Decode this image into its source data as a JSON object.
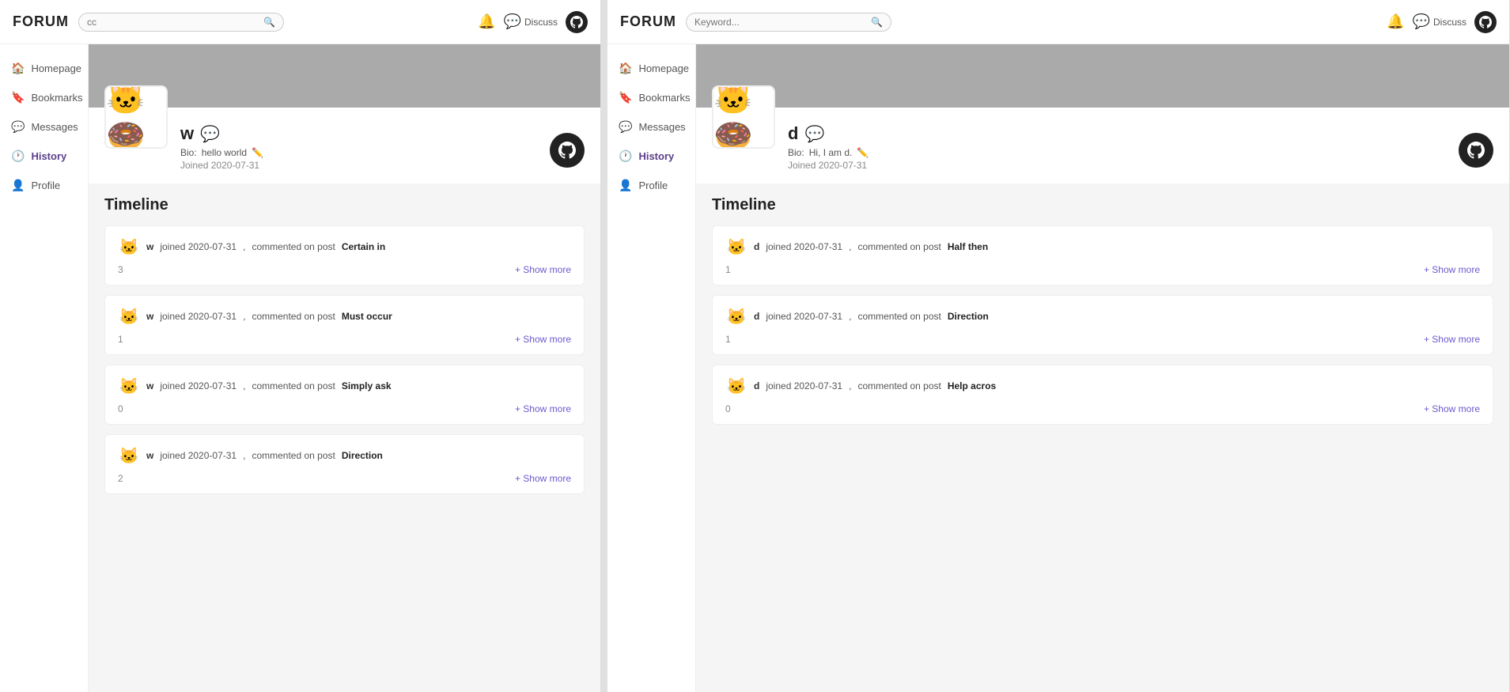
{
  "left": {
    "header": {
      "logo": "FORUM",
      "search_placeholder": "cc",
      "discuss_label": "Discuss"
    },
    "sidebar": {
      "items": [
        {
          "id": "homepage",
          "label": "Homepage",
          "icon": "⌂"
        },
        {
          "id": "bookmarks",
          "label": "Bookmarks",
          "icon": "🔖"
        },
        {
          "id": "messages",
          "label": "Messages",
          "icon": "💬"
        },
        {
          "id": "history",
          "label": "History",
          "icon": "🕐",
          "active": true
        },
        {
          "id": "profile",
          "label": "Profile",
          "icon": "👤"
        }
      ]
    },
    "profile": {
      "username": "w",
      "bio_label": "Bio:",
      "bio_value": "hello world",
      "joined_label": "Joined",
      "joined_date": "2020-07-31",
      "avatar_emoji": "🍩"
    },
    "timeline": {
      "title": "Timeline",
      "entries": [
        {
          "user": "w",
          "joined": "joined 2020-07-31",
          "action": "commented on post",
          "post": "Certain in",
          "count": "3"
        },
        {
          "user": "w",
          "joined": "joined 2020-07-31",
          "action": "commented on post",
          "post": "Must occur",
          "count": "1"
        },
        {
          "user": "w",
          "joined": "joined 2020-07-31",
          "action": "commented on post",
          "post": "Simply ask",
          "count": "0"
        },
        {
          "user": "w",
          "joined": "joined 2020-07-31",
          "action": "commented on post",
          "post": "Direction",
          "count": "2"
        }
      ]
    }
  },
  "right": {
    "header": {
      "logo": "FORUM",
      "search_placeholder": "Keyword...",
      "discuss_label": "Discuss"
    },
    "sidebar": {
      "items": [
        {
          "id": "homepage",
          "label": "Homepage",
          "icon": "⌂"
        },
        {
          "id": "bookmarks",
          "label": "Bookmarks",
          "icon": "🔖"
        },
        {
          "id": "messages",
          "label": "Messages",
          "icon": "💬"
        },
        {
          "id": "history",
          "label": "History",
          "icon": "🕐",
          "active": true
        },
        {
          "id": "profile",
          "label": "Profile",
          "icon": "👤"
        }
      ]
    },
    "profile": {
      "username": "d",
      "bio_label": "Bio:",
      "bio_value": "Hi, I am d.",
      "joined_label": "Joined",
      "joined_date": "2020-07-31",
      "avatar_emoji": "🍩"
    },
    "timeline": {
      "title": "Timeline",
      "entries": [
        {
          "user": "d",
          "joined": "joined 2020-07-31",
          "action": "commented on post",
          "post": "Half then",
          "count": "1"
        },
        {
          "user": "d",
          "joined": "joined 2020-07-31",
          "action": "commented on post",
          "post": "Direction",
          "count": "1"
        },
        {
          "user": "d",
          "joined": "joined 2020-07-31",
          "action": "commented on post",
          "post": "Help acros",
          "count": "0"
        }
      ]
    }
  },
  "show_more_label": "+ Show more",
  "commented_on": "commented on post",
  "edit_icon": "✏",
  "chat_icon": "💬"
}
